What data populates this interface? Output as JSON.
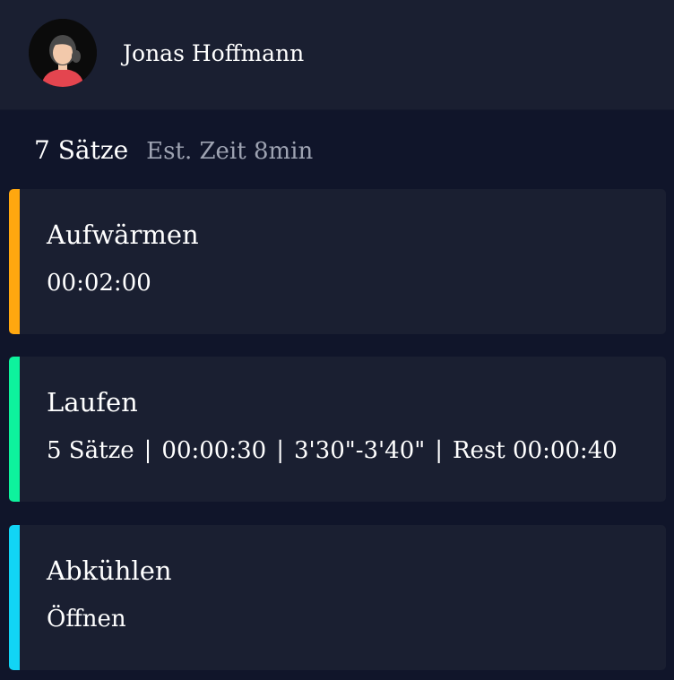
{
  "colors": {
    "background": "#10152a",
    "panel": "#1a1f31",
    "muted_text": "#9ea3b2",
    "warmup_accent": "#ffa70f",
    "run_accent": "#0ef29d",
    "cooldown_accent": "#12d4f5"
  },
  "header": {
    "avatar_icon": "user-avatar-icon",
    "user_name": "Jonas Hoffmann"
  },
  "summary": {
    "sets": "7 Sätze",
    "estimated_time": "Est. Zeit 8min"
  },
  "workout": {
    "warmup": {
      "title": "Aufwärmen",
      "duration": "00:02:00"
    },
    "run": {
      "title": "Laufen",
      "sets": "5 Sätze",
      "interval": "00:00:30",
      "pace": "3'30\"-3'40\"",
      "rest": "Rest 00:00:40",
      "separator": "|"
    },
    "cooldown": {
      "title": "Abkühlen",
      "action": "Öffnen"
    }
  }
}
